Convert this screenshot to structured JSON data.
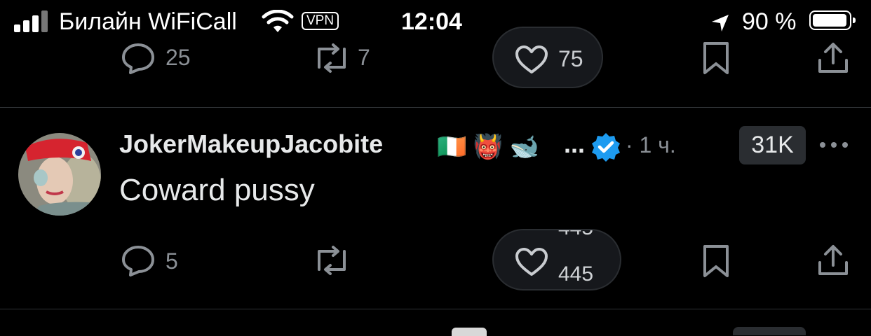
{
  "status_bar": {
    "carrier": "Билайн WiFiCall",
    "vpn": "VPN",
    "time": "12:04",
    "battery_pct": "90 %",
    "signal_bars": 3,
    "battery_level": 0.9
  },
  "prev_tweet": {
    "replies": "25",
    "retweets": "7",
    "likes": "75"
  },
  "tweet": {
    "author": "JokerMakeupJacobite",
    "emojis": "🇮🇪 👹 🐋",
    "ellipsis": "...",
    "time_ago": "· 1 ч.",
    "views_badge": "31K",
    "text": "Coward pussy",
    "replies": "5",
    "likes_top_partial": "445",
    "likes_bottom_partial": "445"
  },
  "colors": {
    "background": "#000000",
    "muted": "#8b9096",
    "verified": "#1d9bf0",
    "divider": "#2f3336"
  }
}
